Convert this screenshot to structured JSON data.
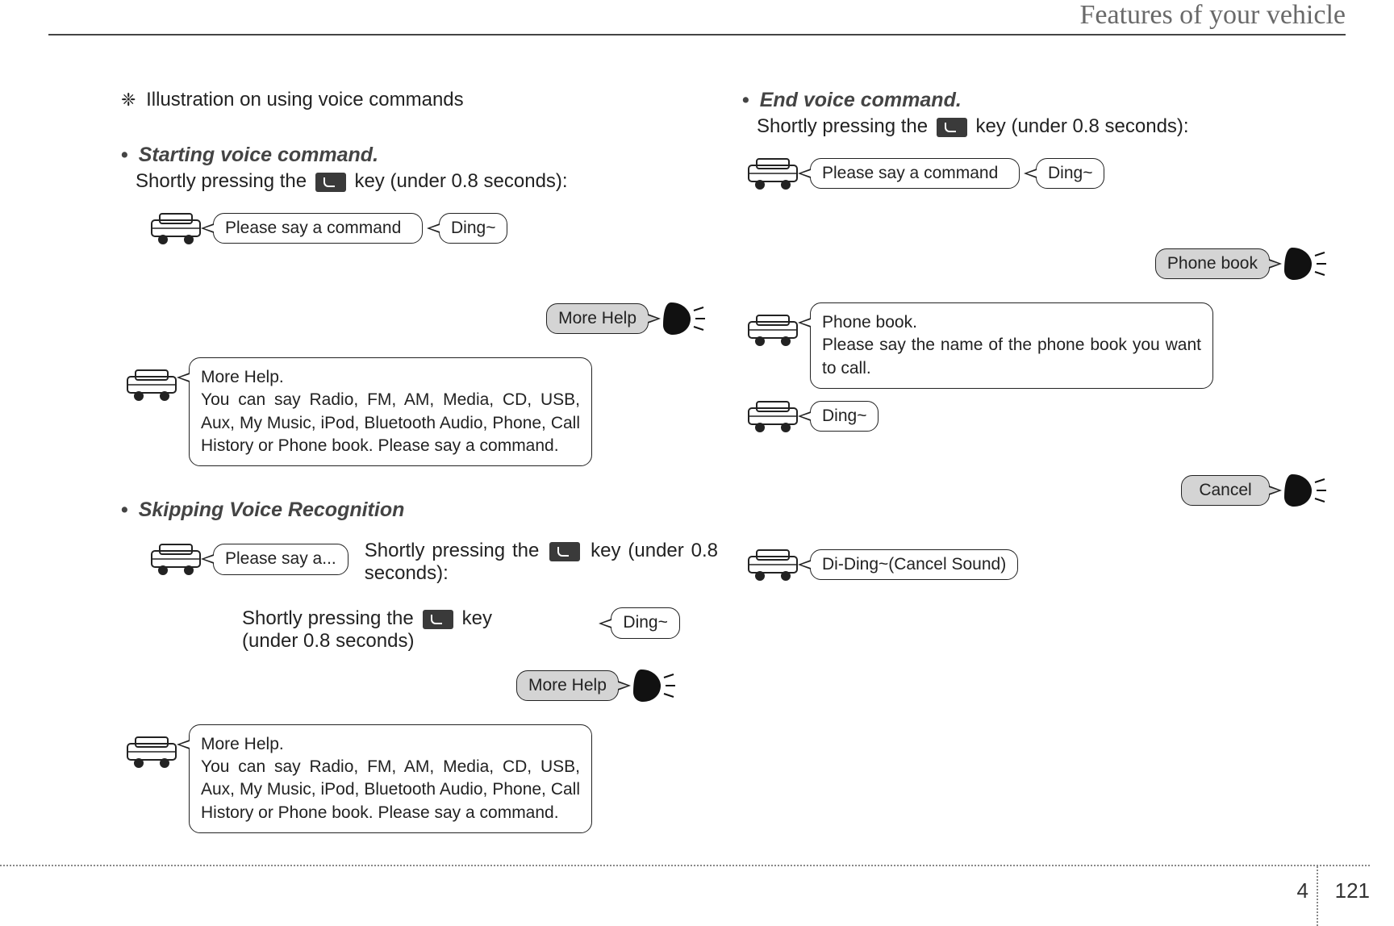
{
  "header": {
    "title": "Features of your vehicle"
  },
  "footer": {
    "chapter": "4",
    "page": "121"
  },
  "left": {
    "illus_label": "Illustration on using voice commands",
    "sec1_head": "Starting voice command.",
    "key_instruction_pre": "Shortly pressing the",
    "key_instruction_post": "key (under 0.8 seconds):",
    "bubble_say_cmd": "Please say a command",
    "bubble_ding": "Ding~",
    "bubble_more_help": "More Help",
    "bubble_more_help_block_l1": "More Help.",
    "bubble_more_help_block_l2": "You can say Radio, FM, AM, Media, CD, USB, Aux, My Music, iPod, Bluetooth Audio, Phone, Call History or Phone book. Please say a command.",
    "sec2_head": "Skipping Voice Recognition",
    "bubble_say_a": "Please say a...",
    "skip_text_1_pre": "Shortly pressing the",
    "skip_text_1_post": "key (under 0.8 seconds):",
    "skip_text_2_pre": "Shortly pressing the",
    "skip_text_2_post": "key (under 0.8 seconds)"
  },
  "right": {
    "sec_head": "End voice command.",
    "key_instruction_pre": "Shortly pressing the",
    "key_instruction_post": "key (under 0.8 seconds):",
    "bubble_say_cmd": "Please say a command",
    "bubble_ding": "Ding~",
    "bubble_phone_book": "Phone book",
    "bubble_phone_book_block_l1": "Phone book.",
    "bubble_phone_book_block_l2": "Please say the name of the phone book you want to call.",
    "bubble_ding2": "Ding~",
    "bubble_cancel": "Cancel",
    "bubble_cancel_sound": "Di-Ding~(Cancel Sound)"
  }
}
